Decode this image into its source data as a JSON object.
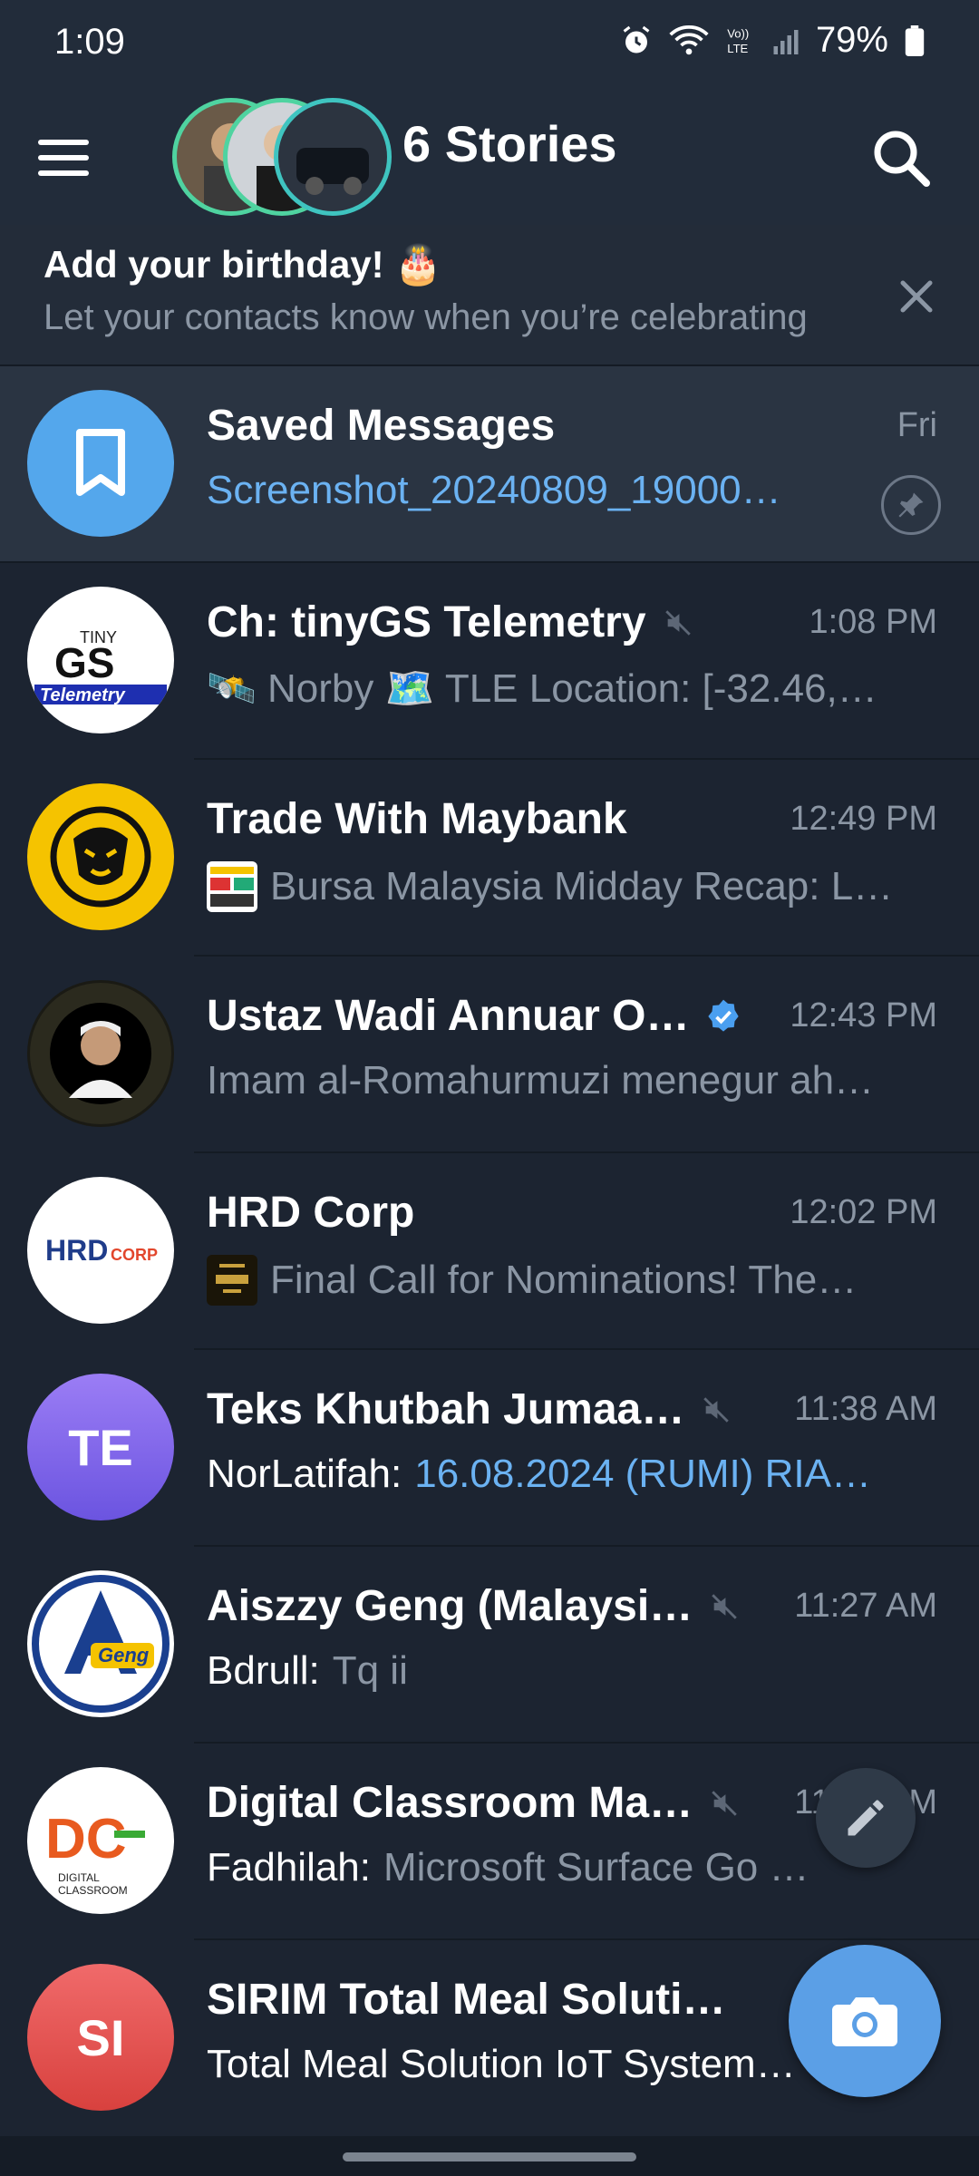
{
  "status": {
    "time": "1:09",
    "battery": "79%"
  },
  "header": {
    "title": "6 Stories"
  },
  "birthday": {
    "title": "Add your birthday! 🎂",
    "subtitle": "Let your contacts know when you’re celebrating"
  },
  "chats": [
    {
      "name": "Saved Messages",
      "time": "Fri",
      "preview": "Screenshot_20240809_19000…"
    },
    {
      "name": "Ch: tinyGS Telemetry",
      "time": "1:08 PM",
      "preview": "🛰️ Norby 🗺️ TLE Location: [-32.46,…",
      "avatar_text": "GS"
    },
    {
      "name": "Trade With Maybank",
      "time": "12:49 PM",
      "preview": "Bursa Malaysia Midday Recap: L…"
    },
    {
      "name": "Ustaz Wadi Annuar O…",
      "time": "12:43 PM",
      "preview": "Imam al-Romahurmuzi menegur ah…"
    },
    {
      "name": "HRD Corp",
      "time": "12:02 PM",
      "preview": "Final Call for Nominations!  The…",
      "avatar_text": "HRDCORP"
    },
    {
      "name": "Teks Khutbah Jumaa…",
      "time": "11:38 AM",
      "sender": "NorLatifah:",
      "preview": "16.08.2024 (RUMI) RIA…",
      "initials": "TE"
    },
    {
      "name": "Aiszzy Geng (Malaysi…",
      "time": "11:27 AM",
      "sender": "Bdrull:",
      "preview": "Tq ii",
      "avatar_text": "Geng"
    },
    {
      "name": "Digital Classroom Ma…",
      "time": "11:09 AM",
      "sender": "Fadhilah:",
      "preview": "Microsoft Surface Go …",
      "avatar_text": "DC"
    },
    {
      "name": "SIRIM Total Meal Soluti…",
      "time": "",
      "preview": "Total Meal Solution IoT System…",
      "initials": "SI"
    }
  ],
  "colors": {
    "background": "#1c2431",
    "header": "#222c3a",
    "accent": "#5b9fe6",
    "link": "#6bb2f2",
    "muted_text": "#8b96a4",
    "verified": "#4a9ff0"
  }
}
